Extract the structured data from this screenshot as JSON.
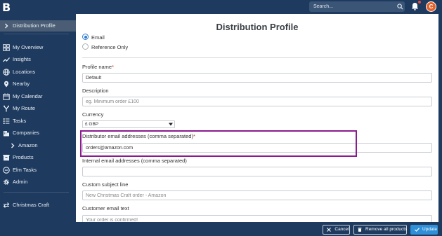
{
  "app": {
    "logo": "B"
  },
  "header": {
    "search_placeholder": "Search...",
    "avatar_initial": "C"
  },
  "sidebar": {
    "items": [
      {
        "label": "Distribution Profile",
        "icon": "chevron-right-icon",
        "active": true
      },
      {
        "label": "My Overview",
        "icon": "dashboard-icon"
      },
      {
        "label": "Insights",
        "icon": "trend-line-icon"
      },
      {
        "label": "Locations",
        "icon": "globe-icon"
      },
      {
        "label": "Nearby",
        "icon": "map-pin-icon"
      },
      {
        "label": "My Calendar",
        "icon": "calendar-icon"
      },
      {
        "label": "My Route",
        "icon": "route-fork-icon"
      },
      {
        "label": "Tasks",
        "icon": "tasks-icon"
      },
      {
        "label": "Companies",
        "icon": "building-icon"
      },
      {
        "label": "Amazon",
        "icon": "chevron-right-icon"
      },
      {
        "label": "Products",
        "icon": "box-icon"
      },
      {
        "label": "Elm Tasks",
        "icon": "circle-minus-icon"
      },
      {
        "label": "Admin",
        "icon": "gear-icon"
      },
      {
        "label": "Christmas Craft",
        "icon": "swap-arrows-icon"
      }
    ]
  },
  "main": {
    "title": "Distribution Profile",
    "radios": [
      {
        "label": "Email",
        "checked": true
      },
      {
        "label": "Reference Only",
        "checked": false
      }
    ],
    "profile_name": {
      "label": "Profile name",
      "value": "Default"
    },
    "description": {
      "label": "Description",
      "placeholder": "eg. Minimum order £100"
    },
    "currency": {
      "label": "Currency",
      "value": "£ GBP"
    },
    "distributor_emails": {
      "label": "Distributor email addresses (comma separated)",
      "value": "orders@amazon.com"
    },
    "internal_emails": {
      "label": "Internal email addresses (comma separated)",
      "value": ""
    },
    "custom_subject": {
      "label": "Custom subject line",
      "placeholder": "New Christmas Craft order - Amazon"
    },
    "customer_email": {
      "label": "Customer email text",
      "placeholder": "Your order is confirmed!"
    }
  },
  "footer": {
    "cancel_label": "Cancel",
    "remove_label": "Remove all products",
    "update_label": "Update"
  },
  "colors": {
    "background": "#1e3a5f",
    "accent": "#2f8fd8",
    "highlight_box": "#8b1a8f",
    "avatar": "#e4612a",
    "required": "#c0392b"
  }
}
